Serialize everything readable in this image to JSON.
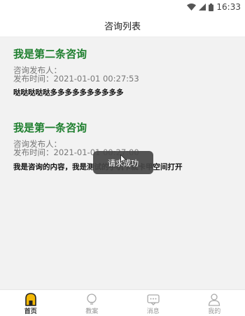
{
  "status": {
    "time": "16:33"
  },
  "header": {
    "title": "咨询列表"
  },
  "items": [
    {
      "title": "我是第二条咨询",
      "publisher_label": "咨询发布人：",
      "time_label": "发布时间：",
      "time_value": "2021-01-01 00:27:53",
      "content": "哒哒哒哒哒多多多多多多多多多多"
    },
    {
      "title": "我是第一条咨询",
      "publisher_label": "咨询发布人：",
      "time_label": "发布时间：",
      "time_value": "2021-01-01 00:27:00",
      "content": "我是咨询的内容，我是测试的手机卡就卡甲空间打开"
    }
  ],
  "toast": {
    "text": "请求成功"
  },
  "tabs": [
    {
      "label": "首页",
      "icon": "home-icon",
      "active": true
    },
    {
      "label": "教案",
      "icon": "bulb-icon",
      "active": false
    },
    {
      "label": "消息",
      "icon": "message-icon",
      "active": false
    },
    {
      "label": "我的",
      "icon": "user-icon",
      "active": false
    }
  ],
  "colors": {
    "title_green": "#1e7f2e",
    "tab_active_accent": "#f2b705"
  }
}
